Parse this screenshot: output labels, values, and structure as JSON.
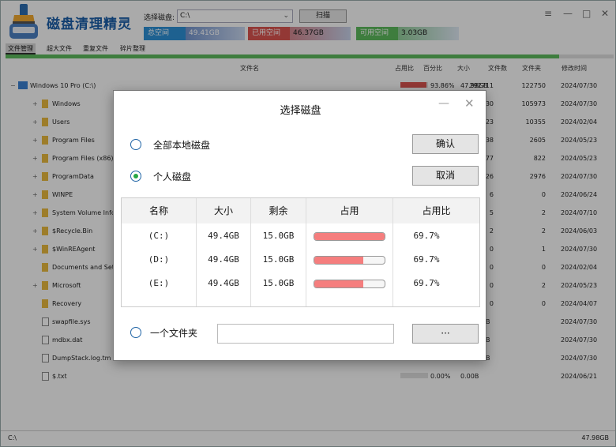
{
  "app": {
    "title": "磁盘清理精灵"
  },
  "toolbar": {
    "drive_label": "选择磁盘:",
    "drive_value": "C:\\",
    "scan_label": "扫描"
  },
  "stats": [
    {
      "label": "总空间",
      "value": "49.41GB",
      "color": "#3a67b6"
    },
    {
      "label": "已用空间",
      "value": "46.37GB",
      "color": "#d9534f"
    },
    {
      "label": "可用空间",
      "value": "3.03GB",
      "color": "#5cb85c"
    }
  ],
  "window_controls": {
    "menu": "≡",
    "minimize": "—",
    "maximize": "□",
    "close": "✕"
  },
  "tabs": [
    "文件管理",
    "超大文件",
    "重复文件",
    "碎片整理"
  ],
  "scan_progress": 0.91,
  "columns": [
    "文件名",
    "占用比",
    "百分比",
    "大小",
    "文件数",
    "文件夹",
    "修改时间"
  ],
  "rows": [
    {
      "expander": "−",
      "type": "drive",
      "name": "Windows 10 Pro (C:\\)",
      "pct": "93.86%",
      "ratio": 0.94,
      "size": "47.98GB",
      "files": "292711",
      "folders": "122750",
      "date": "2024/07/30"
    },
    {
      "expander": "+",
      "type": "folder",
      "name": "Windows",
      "files": "219930",
      "folders": "105973",
      "date": "2024/07/30"
    },
    {
      "expander": "+",
      "type": "folder",
      "name": "Users",
      "files": "33123",
      "folders": "10355",
      "date": "2024/02/04"
    },
    {
      "expander": "+",
      "type": "folder",
      "name": "Program Files",
      "files": "19438",
      "folders": "2605",
      "date": "2024/05/23"
    },
    {
      "expander": "+",
      "type": "folder",
      "name": "Program Files (x86)",
      "files": "5377",
      "folders": "822",
      "date": "2024/05/23"
    },
    {
      "expander": "+",
      "type": "folder",
      "name": "ProgramData",
      "files": "14826",
      "folders": "2976",
      "date": "2024/07/30"
    },
    {
      "expander": "+",
      "type": "folder",
      "name": "WINPE",
      "files": "6",
      "folders": "0",
      "date": "2024/06/24"
    },
    {
      "expander": "+",
      "type": "folder",
      "name": "System Volume Info",
      "files": "5",
      "folders": "2",
      "date": "2024/07/10"
    },
    {
      "expander": "+",
      "type": "folder",
      "name": "$Recycle.Bin",
      "files": "2",
      "folders": "2",
      "date": "2024/06/03"
    },
    {
      "expander": "+",
      "type": "folder",
      "name": "$WinREAgent",
      "files": "0",
      "folders": "1",
      "date": "2024/07/30"
    },
    {
      "expander": "",
      "type": "folder",
      "name": "Documents and Set",
      "files": "0",
      "folders": "0",
      "date": "2024/02/04"
    },
    {
      "expander": "+",
      "type": "folder",
      "name": "Microsoft",
      "files": "0",
      "folders": "2",
      "date": "2024/05/23"
    },
    {
      "expander": "",
      "type": "folder",
      "name": "Recovery",
      "files": "0",
      "folders": "0",
      "date": "2024/04/07"
    },
    {
      "expander": "",
      "type": "file",
      "name": "swapfile.sys",
      "size": "B",
      "date": "2024/07/30"
    },
    {
      "expander": "",
      "type": "file",
      "name": "mdbx.dat",
      "size": "B",
      "date": "2024/07/30"
    },
    {
      "expander": "",
      "type": "file",
      "name": "DumpStack.log.tm",
      "size": "B",
      "date": "2024/07/30"
    },
    {
      "expander": "",
      "type": "file",
      "name": "$.txt",
      "pct": "0.00%",
      "ratio": 0.0,
      "size": "0.00B",
      "date": "2024/06/21"
    }
  ],
  "status": {
    "path": "C:\\",
    "size": "47.98GB"
  },
  "dialog": {
    "title": "选择磁盘",
    "minimize": "—",
    "close": "✕",
    "option_all": "全部本地磁盘",
    "option_personal": "个人磁盘",
    "option_folder": "一个文件夹",
    "folder_path": "",
    "confirm": "确认",
    "cancel": "取消",
    "browse": "···",
    "table_headers": [
      "名称",
      "大小",
      "剩余",
      "占用",
      "占用比"
    ],
    "disks": [
      {
        "name": "(C:)",
        "size": "49.4GB",
        "free": "15.0GB",
        "usage": 1.0,
        "ratio": "69.7%"
      },
      {
        "name": "(D:)",
        "size": "49.4GB",
        "free": "15.0GB",
        "usage": 0.7,
        "ratio": "69.7%"
      },
      {
        "name": "(E:)",
        "size": "49.4GB",
        "free": "15.0GB",
        "usage": 0.7,
        "ratio": "69.7%"
      }
    ]
  }
}
